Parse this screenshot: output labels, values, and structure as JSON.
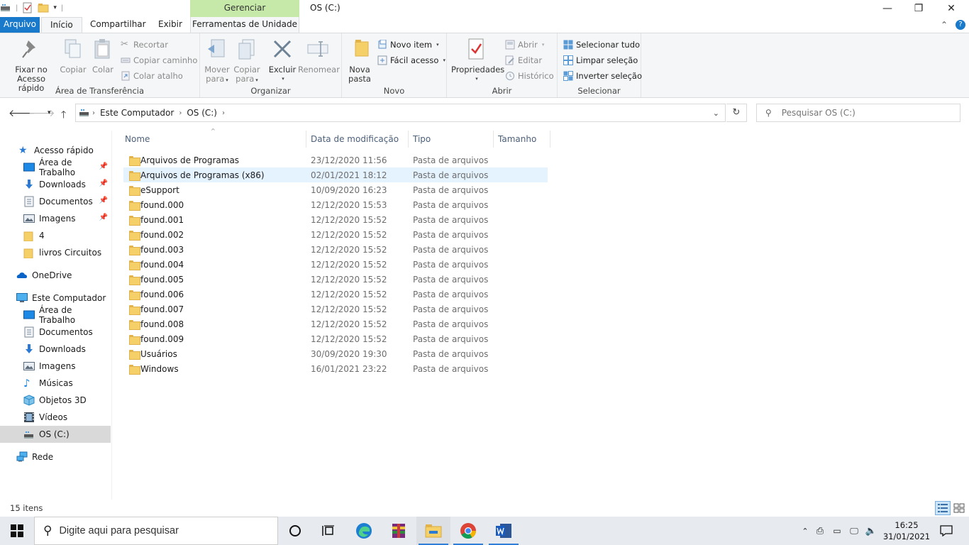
{
  "window": {
    "title": "OS (C:)",
    "manage_label": "Gerenciar",
    "minimize": "—",
    "maximize": "❐",
    "close": "✕"
  },
  "ribbon_tabs": {
    "file": "Arquivo",
    "home": "Início",
    "share": "Compartilhar",
    "view": "Exibir",
    "drive_tools": "Ferramentas de Unidade"
  },
  "ribbon": {
    "clipboard": {
      "label": "Área de Transferência",
      "pin": "Fixar no\nAcesso rápido",
      "pin_l1": "Fixar no",
      "pin_l2": "Acesso rápido",
      "copy": "Copiar",
      "paste": "Colar",
      "cut": "Recortar",
      "copy_path": "Copiar caminho",
      "paste_shortcut": "Colar atalho"
    },
    "organize": {
      "label": "Organizar",
      "move_l1": "Mover",
      "move_l2": "para",
      "copy_l1": "Copiar",
      "copy_l2": "para",
      "delete": "Excluir",
      "rename": "Renomear"
    },
    "new": {
      "label": "Novo",
      "new_folder_l1": "Nova",
      "new_folder_l2": "pasta",
      "new_item": "Novo item",
      "easy_access": "Fácil acesso"
    },
    "open": {
      "label": "Abrir",
      "properties": "Propriedades",
      "open": "Abrir",
      "edit": "Editar",
      "history": "Histórico"
    },
    "select": {
      "label": "Selecionar",
      "select_all": "Selecionar tudo",
      "select_none": "Limpar seleção",
      "invert": "Inverter seleção"
    }
  },
  "address": {
    "crumbs": [
      "Este Computador",
      "OS (C:)"
    ],
    "search_placeholder": "Pesquisar OS (C:)"
  },
  "nav": {
    "quick_access": "Acesso rápido",
    "quick_items": [
      "Área de Trabalho",
      "Downloads",
      "Documentos",
      "Imagens",
      "4",
      "livros Circuitos"
    ],
    "onedrive": "OneDrive",
    "this_pc": "Este Computador",
    "pc_items": [
      "Área de Trabalho",
      "Documentos",
      "Downloads",
      "Imagens",
      "Músicas",
      "Objetos 3D",
      "Vídeos",
      "OS (C:)"
    ],
    "network": "Rede"
  },
  "columns": {
    "name": "Nome",
    "date": "Data de modificação",
    "type": "Tipo",
    "size": "Tamanho"
  },
  "files": [
    {
      "name": "Arquivos de Programas",
      "date": "23/12/2020 11:56",
      "type": "Pasta de arquivos"
    },
    {
      "name": "Arquivos de Programas (x86)",
      "date": "02/01/2021 18:12",
      "type": "Pasta de arquivos"
    },
    {
      "name": "eSupport",
      "date": "10/09/2020 16:23",
      "type": "Pasta de arquivos"
    },
    {
      "name": "found.000",
      "date": "12/12/2020 15:53",
      "type": "Pasta de arquivos"
    },
    {
      "name": "found.001",
      "date": "12/12/2020 15:52",
      "type": "Pasta de arquivos"
    },
    {
      "name": "found.002",
      "date": "12/12/2020 15:52",
      "type": "Pasta de arquivos"
    },
    {
      "name": "found.003",
      "date": "12/12/2020 15:52",
      "type": "Pasta de arquivos"
    },
    {
      "name": "found.004",
      "date": "12/12/2020 15:52",
      "type": "Pasta de arquivos"
    },
    {
      "name": "found.005",
      "date": "12/12/2020 15:52",
      "type": "Pasta de arquivos"
    },
    {
      "name": "found.006",
      "date": "12/12/2020 15:52",
      "type": "Pasta de arquivos"
    },
    {
      "name": "found.007",
      "date": "12/12/2020 15:52",
      "type": "Pasta de arquivos"
    },
    {
      "name": "found.008",
      "date": "12/12/2020 15:52",
      "type": "Pasta de arquivos"
    },
    {
      "name": "found.009",
      "date": "12/12/2020 15:52",
      "type": "Pasta de arquivos"
    },
    {
      "name": "Usuários",
      "date": "30/09/2020 19:30",
      "type": "Pasta de arquivos"
    },
    {
      "name": "Windows",
      "date": "16/01/2021 23:22",
      "type": "Pasta de arquivos"
    }
  ],
  "status": {
    "item_count": "15 itens"
  },
  "taskbar": {
    "search_placeholder": "Digite aqui para pesquisar",
    "time": "16:25",
    "date": "31/01/2021"
  },
  "colors": {
    "accent": "#1979ca",
    "manage_tab": "#c6e9a9",
    "folder": "#f5cf67",
    "hover_row": "#e5f3ff",
    "selected_nav": "#d9d9d9"
  }
}
